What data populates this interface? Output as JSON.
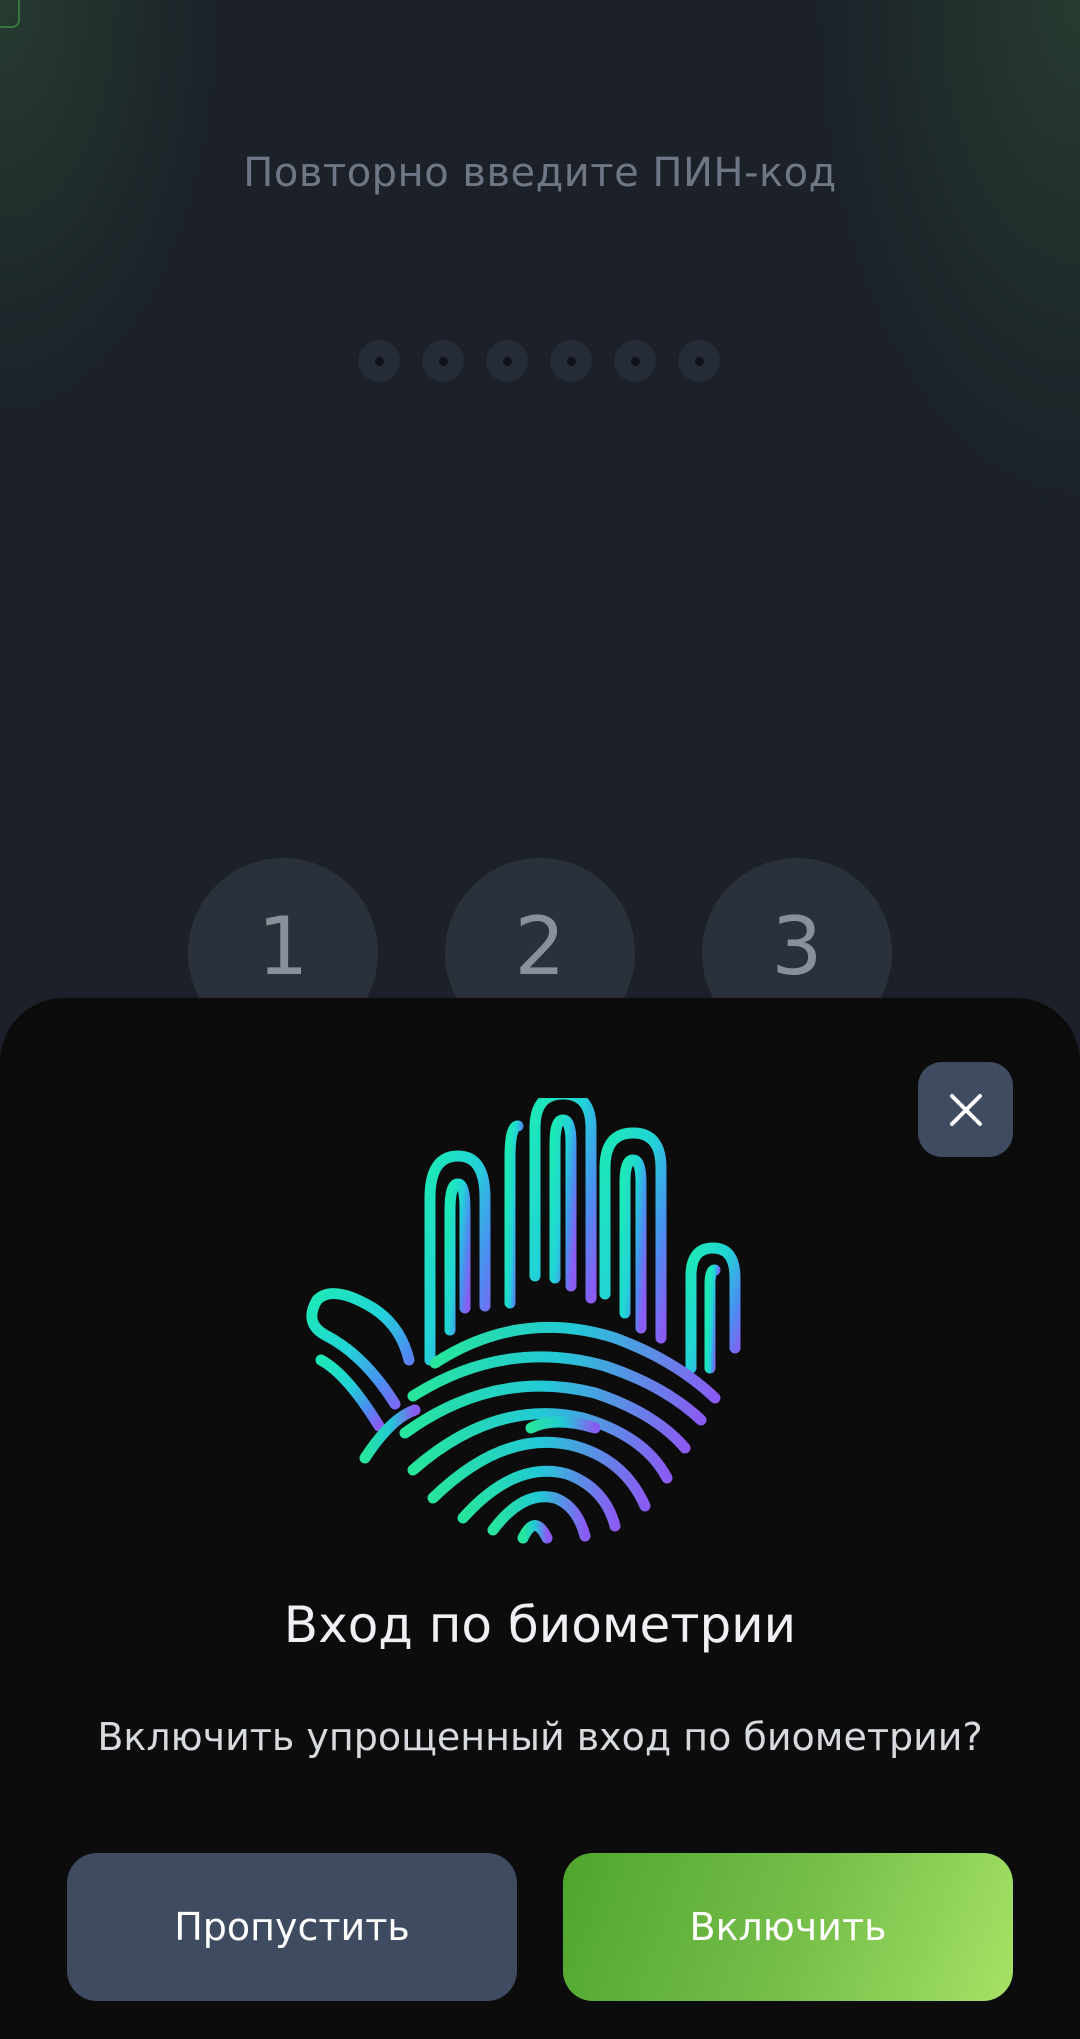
{
  "pin_screen": {
    "title": "Повторно введите ПИН-код",
    "pin_length": 6,
    "keys": [
      "1",
      "2",
      "3"
    ]
  },
  "biometric_sheet": {
    "title": "Вход по биометрии",
    "subtitle": "Включить упрощенный вход по биометрии?",
    "close_icon": "close-icon",
    "hand_icon": "palm-fingerprint-icon",
    "skip_label": "Пропустить",
    "enable_label": "Включить"
  },
  "colors": {
    "background": "#1b2029",
    "sheet": "#0c0c0d",
    "secondary_button": "#3e4b61",
    "primary_button_start": "#4fa52f",
    "primary_button_end": "#a6e266",
    "icon_teal": "#22e6c8",
    "icon_violet": "#7a5cf0"
  }
}
